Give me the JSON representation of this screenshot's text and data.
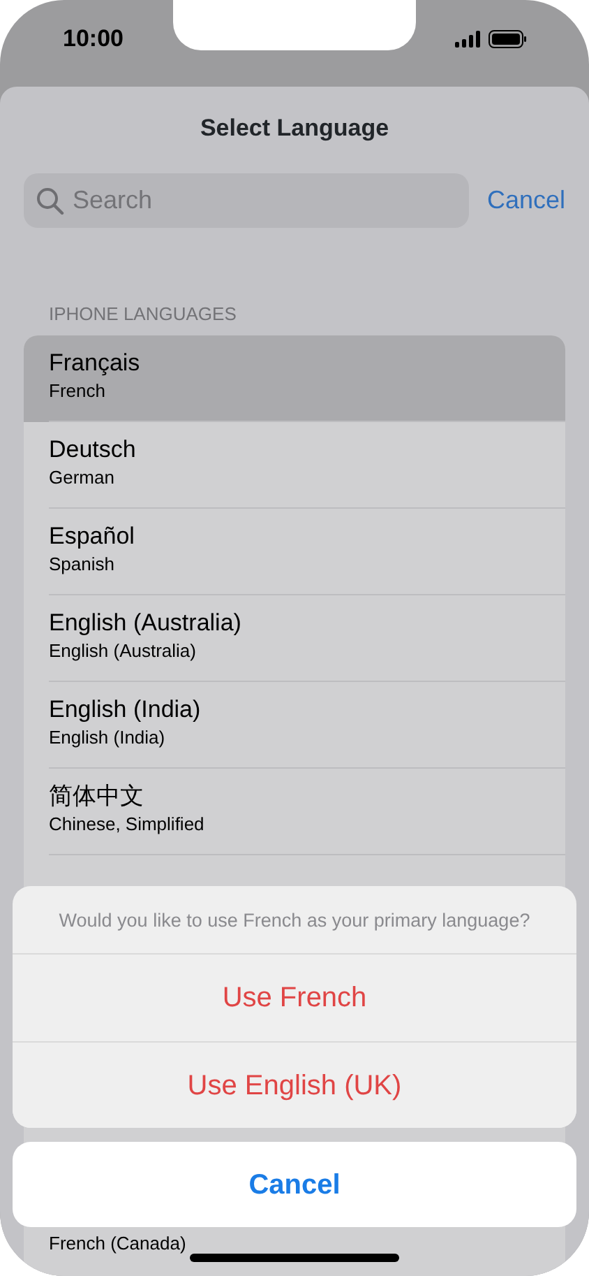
{
  "status_bar": {
    "time": "10:00"
  },
  "header": {
    "title": "Select Language"
  },
  "search": {
    "placeholder": "Search",
    "cancel": "Cancel"
  },
  "section": {
    "title": "IPHONE LANGUAGES"
  },
  "languages": [
    {
      "name": "Français",
      "translation": "French",
      "selected": true
    },
    {
      "name": "Deutsch",
      "translation": "German",
      "selected": false
    },
    {
      "name": "Español",
      "translation": "Spanish",
      "selected": false
    },
    {
      "name": "English (Australia)",
      "translation": "English (Australia)",
      "selected": false
    },
    {
      "name": "English (India)",
      "translation": "English (India)",
      "selected": false
    },
    {
      "name": "简体中文",
      "translation": "Chinese, Simplified",
      "selected": false
    }
  ],
  "languages_lower": [
    {
      "translation": "French (Canada)",
      "selected": false
    }
  ],
  "action_sheet": {
    "message": "Would you like to use French as your primary language?",
    "actions": [
      {
        "label": "Use French",
        "kind": "destructive"
      },
      {
        "label": "Use English (UK)",
        "kind": "destructive"
      }
    ],
    "cancel": "Cancel"
  }
}
